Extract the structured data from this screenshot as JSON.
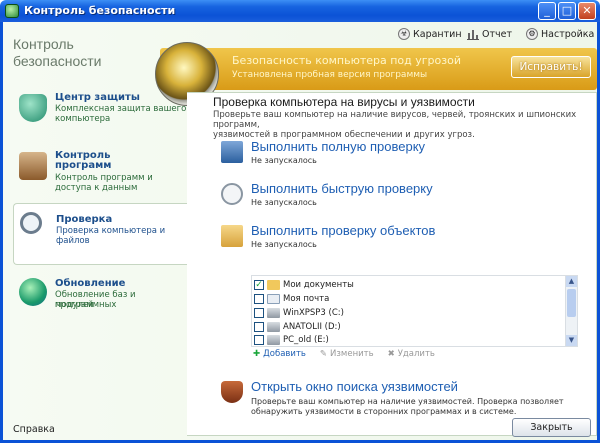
{
  "window": {
    "title": "Контроль безопасности",
    "controls": {
      "minimize": "_",
      "maximize": "□",
      "close": "✕"
    }
  },
  "app_title_line1": "Контроль",
  "app_title_line2": "безопасности",
  "toplinks": {
    "quarantine": "Карантин",
    "report": "Отчет",
    "settings": "Настройка"
  },
  "banner": {
    "title": "Безопасность компьютера под угрозой",
    "subtitle": "Установлена пробная версия программы",
    "fix_button": "Исправить!"
  },
  "sidebar": {
    "items": [
      {
        "title": "Центр защиты",
        "desc1": "Комплексная защита вашего",
        "desc2": "компьютера",
        "desc3": ""
      },
      {
        "title": "Контроль",
        "title2": "программ",
        "desc1": "Контроль программ и",
        "desc2": "доступа к данным",
        "desc3": ""
      },
      {
        "title": "Проверка",
        "desc1": "Проверка компьютера и",
        "desc2": "файлов",
        "desc3": ""
      },
      {
        "title": "Обновление",
        "desc1": "Обновление баз и программных",
        "desc2": "модулей",
        "desc3": ""
      }
    ]
  },
  "main": {
    "title": "Проверка компьютера на вирусы и уязвимости",
    "desc_line1": "Проверьте ваш компьютер на наличие вирусов, червей, троянских и шпионских программ,",
    "desc_line2": "уязвимостей в программном обеспечении и других угроз.",
    "scans": [
      {
        "title": "Выполнить полную проверку",
        "status": "Не запускалось"
      },
      {
        "title": "Выполнить быструю проверку",
        "status": "Не запускалось"
      },
      {
        "title": "Выполнить проверку объектов",
        "status": "Не запускалось"
      }
    ],
    "objects": [
      {
        "label": "Мои документы",
        "checked": true,
        "check_mark": "✓",
        "icon": "folder-icon"
      },
      {
        "label": "Моя почта",
        "checked": false,
        "check_mark": "",
        "icon": "mail-icon"
      },
      {
        "label": "WinXPSP3 (C:)",
        "checked": false,
        "check_mark": "",
        "icon": "drive-icon"
      },
      {
        "label": "ANATOLII (D:)",
        "checked": false,
        "check_mark": "",
        "icon": "drive-icon"
      },
      {
        "label": "PC_old (E:)",
        "checked": false,
        "check_mark": "",
        "icon": "drive-icon"
      }
    ],
    "actions": {
      "add": "Добавить",
      "edit": "Изменить",
      "delete": "Удалить"
    },
    "vuln": {
      "title": "Открыть окно поиска уязвимостей",
      "desc_line1": "Проверьте ваш компьютер на наличие уязвимостей. Проверка позволяет",
      "desc_line2": "обнаружить уязвимости в сторонних программах и в системе."
    }
  },
  "footer": {
    "help": "Справка",
    "close": "Закрыть"
  },
  "colors": {
    "titlebar": "#0b52d6",
    "banner": "#e0a726",
    "link_blue": "#1f5fb3",
    "nav_green": "#2b6a3a"
  }
}
